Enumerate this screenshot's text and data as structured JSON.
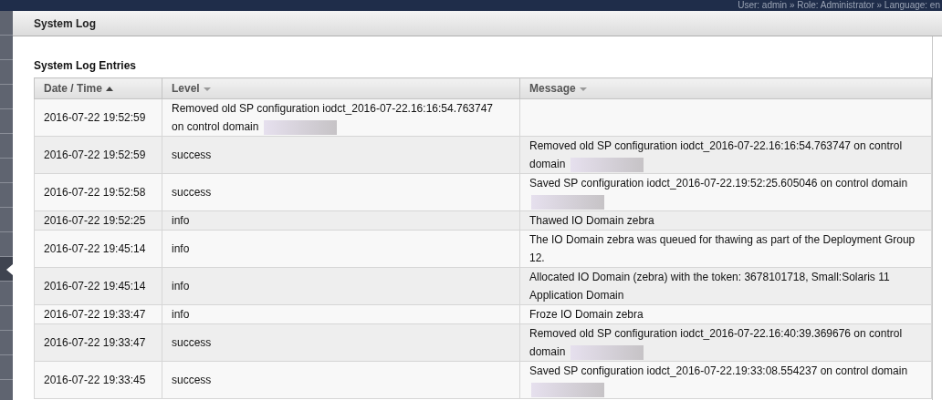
{
  "top_bar": {
    "text": "User: admin » Role: Administrator » Language: en"
  },
  "sidebar": {
    "items": [
      {
        "selected": false
      },
      {
        "selected": false
      },
      {
        "selected": false
      },
      {
        "selected": false
      },
      {
        "selected": false
      },
      {
        "selected": false
      },
      {
        "selected": false
      },
      {
        "selected": false
      },
      {
        "selected": false
      },
      {
        "selected": false
      },
      {
        "selected": true
      },
      {
        "selected": false
      },
      {
        "selected": false
      },
      {
        "selected": false
      },
      {
        "selected": false
      }
    ]
  },
  "page": {
    "title": "System Log"
  },
  "section": {
    "title": "System Log Entries"
  },
  "table": {
    "columns": [
      {
        "label": "Date / Time",
        "sorted": true
      },
      {
        "label": "Level",
        "sorted": false
      },
      {
        "label": "Message",
        "sorted": false
      }
    ],
    "rows": [
      {
        "time": "2016-07-22 19:52:59",
        "level": "Removed old SP configuration iodct_2016-07-22.16:16:54.763747 on control domain",
        "level_redacted": true,
        "message": "",
        "message_redacted": false
      },
      {
        "time": "2016-07-22 19:52:59",
        "level": "success",
        "level_redacted": false,
        "message": "Removed old SP configuration iodct_2016-07-22.16:16:54.763747 on control domain",
        "message_redacted": true
      },
      {
        "time": "2016-07-22 19:52:58",
        "level": "success",
        "level_redacted": false,
        "message": "Saved SP configuration iodct_2016-07-22.19:52:25.605046 on control domain",
        "message_redacted": true
      },
      {
        "time": "2016-07-22 19:52:25",
        "level": "info",
        "level_redacted": false,
        "message": "Thawed IO Domain zebra",
        "message_redacted": false
      },
      {
        "time": "2016-07-22 19:45:14",
        "level": "info",
        "level_redacted": false,
        "message": "The IO Domain zebra was queued for thawing as part of the Deployment Group 12.",
        "message_redacted": false
      },
      {
        "time": "2016-07-22 19:45:14",
        "level": "info",
        "level_redacted": false,
        "message": "Allocated IO Domain (zebra) with the token: 3678101718, Small:Solaris 11 Application Domain",
        "message_redacted": false
      },
      {
        "time": "2016-07-22 19:33:47",
        "level": "info",
        "level_redacted": false,
        "message": "Froze IO Domain zebra",
        "message_redacted": false
      },
      {
        "time": "2016-07-22 19:33:47",
        "level": "success",
        "level_redacted": false,
        "message": "Removed old SP configuration iodct_2016-07-22.16:40:39.369676 on control domain",
        "message_redacted": true
      },
      {
        "time": "2016-07-22 19:33:45",
        "level": "success",
        "level_redacted": false,
        "message": "Saved SP configuration iodct_2016-07-22.19:33:08.554237 on control domain",
        "message_redacted": true
      }
    ]
  }
}
